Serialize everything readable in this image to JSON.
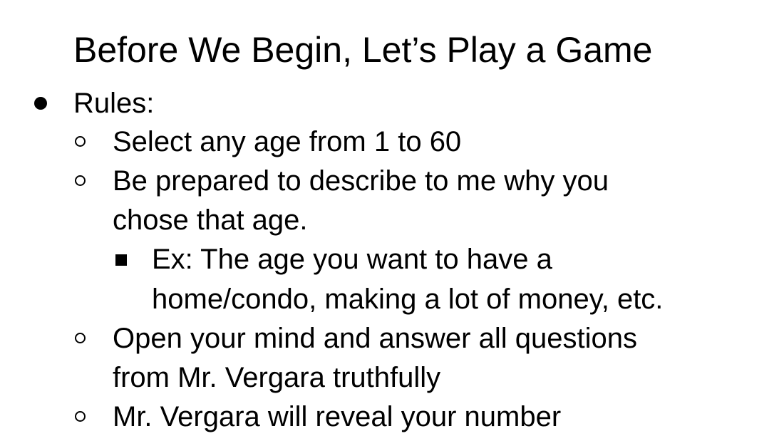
{
  "title": "Before We Begin, Let’s Play a Game",
  "bullets": {
    "rules": "Rules:",
    "item1": "Select any age from 1 to 60",
    "item2_line1": "Be prepared to describe to me why you",
    "item2_line2": "chose that age.",
    "item2_sub_line1": "Ex: The age you want to have a",
    "item2_sub_line2": "home/condo, making a lot of money, etc.",
    "item3_line1": "Open your mind and answer all questions",
    "item3_line2": "from Mr. Vergara truthfully",
    "item4": "Mr. Vergara will reveal your number"
  }
}
